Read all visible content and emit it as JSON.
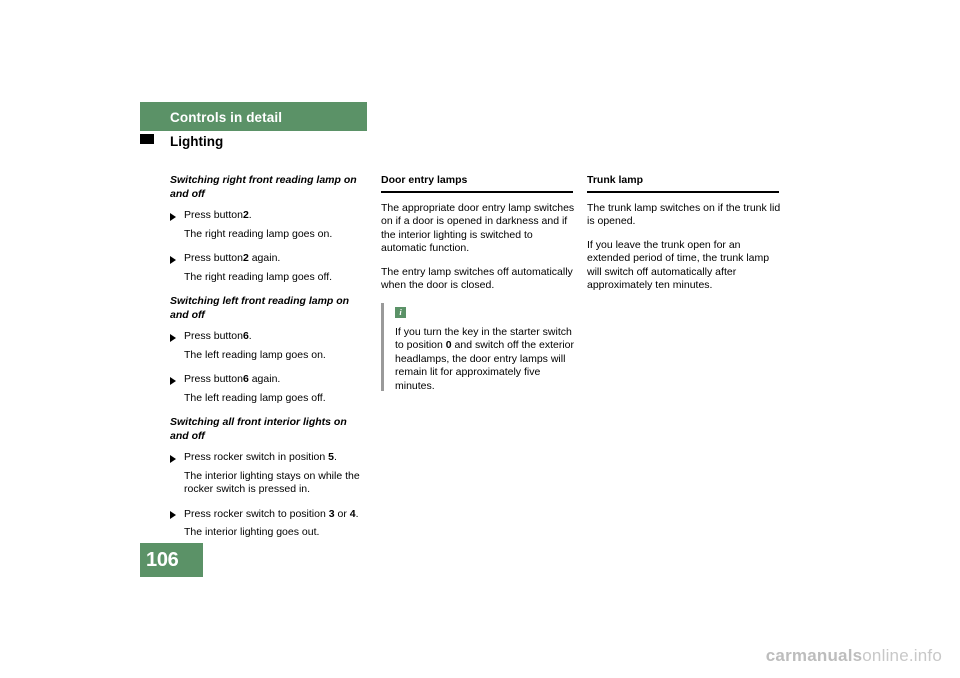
{
  "header": {
    "band_title": "Controls in detail",
    "section_title": "Lighting"
  },
  "page_number": "106",
  "columns": {
    "col1": {
      "sub1": "Switching right front reading lamp on and off",
      "b1": "Press button",
      "b1_num": "2",
      "b1_end": ".",
      "n1": "The right reading lamp goes on.",
      "b2": "Press button",
      "b2_num": "2",
      "b2_end": " again.",
      "n2": "The right reading lamp goes off.",
      "sub2": "Switching left front reading lamp on and off",
      "b3": "Press button",
      "b3_num": "6",
      "b3_end": ".",
      "n3": "The left reading lamp goes on.",
      "b4": "Press button",
      "b4_num": "6",
      "b4_end": " again.",
      "n4": "The left reading lamp goes off.",
      "sub3": "Switching all front interior lights on and off",
      "b5": "Press rocker switch in position",
      "b5_num": "5",
      "b5_end": ".",
      "n5": "The interior lighting stays on while the rocker switch is pressed in.",
      "b6": "Press rocker switch to position",
      "b6_num": "3",
      "b6_mid": " or ",
      "b6_num2": "4",
      "b6_end": ".",
      "n6": "The interior lighting goes out."
    },
    "col2": {
      "heading": "Door entry lamps",
      "p1": "The appropriate door entry lamp switches on if a door is opened in darkness and if the interior lighting is switched to automatic function.",
      "p2": "The entry lamp switches off automatically when the door is closed.",
      "info_icon_glyph": "i",
      "info_p1": "If you turn the key in the starter switch to position",
      "info_num": "0",
      "info_p2": " and switch off the exterior headlamps, the door entry lamps will remain lit for approximately five minutes."
    },
    "col3": {
      "heading": "Trunk lamp",
      "p1": "The trunk lamp switches on if the trunk lid is opened.",
      "p2": "If you leave the trunk open for an extended period of time, the trunk lamp will switch off automatically after approximately ten minutes."
    }
  },
  "watermark": {
    "part1": "carmanuals",
    "part2": "online.info"
  }
}
